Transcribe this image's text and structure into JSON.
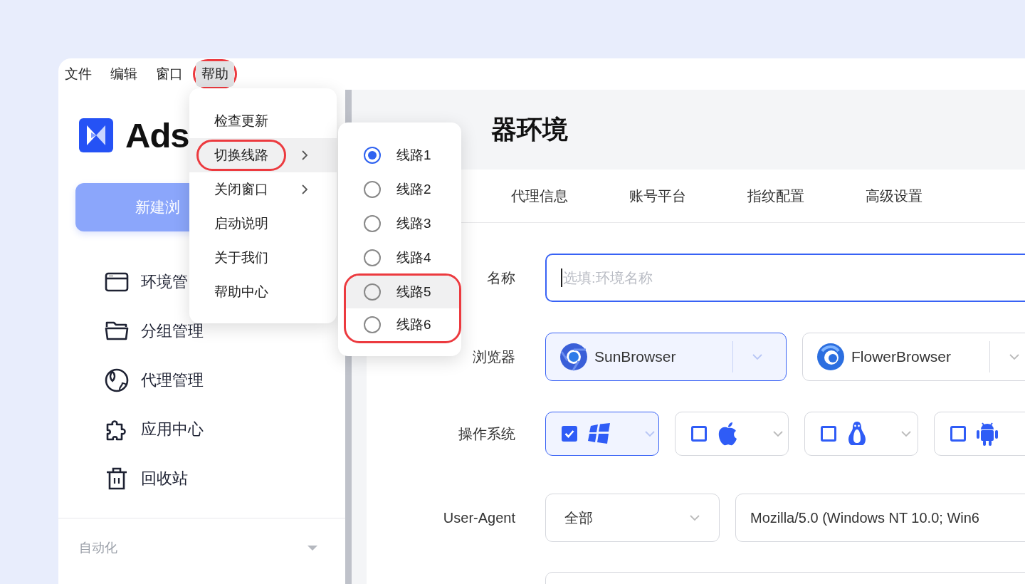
{
  "menubar": [
    {
      "label": "文件",
      "open": false,
      "annotated": false
    },
    {
      "label": "编辑",
      "open": false,
      "annotated": false
    },
    {
      "label": "窗口",
      "open": false,
      "annotated": false
    },
    {
      "label": "帮助",
      "open": true,
      "annotated": true
    }
  ],
  "help_menu": [
    {
      "label": "检查更新",
      "submenu": false,
      "highlighted": false,
      "annotated": false
    },
    {
      "label": "切换线路",
      "submenu": true,
      "highlighted": true,
      "annotated": true
    },
    {
      "label": "关闭窗口",
      "submenu": true,
      "highlighted": false,
      "annotated": false
    },
    {
      "label": "启动说明",
      "submenu": false,
      "highlighted": false,
      "annotated": false
    },
    {
      "label": "关于我们",
      "submenu": false,
      "highlighted": false,
      "annotated": false
    },
    {
      "label": "帮助中心",
      "submenu": false,
      "highlighted": false,
      "annotated": false
    }
  ],
  "route_menu": [
    {
      "label": "线路1",
      "selected": true,
      "highlighted": false,
      "annotated": false
    },
    {
      "label": "线路2",
      "selected": false,
      "highlighted": false,
      "annotated": false
    },
    {
      "label": "线路3",
      "selected": false,
      "highlighted": false,
      "annotated": false
    },
    {
      "label": "线路4",
      "selected": false,
      "highlighted": false,
      "annotated": false
    },
    {
      "label": "线路5",
      "selected": false,
      "highlighted": true,
      "annotated": true
    },
    {
      "label": "线路6",
      "selected": false,
      "highlighted": false,
      "annotated": true
    }
  ],
  "sidebar": {
    "logo_text": "Ads",
    "new_button": "新建浏",
    "nav": [
      {
        "label": "环境管",
        "selected": false
      },
      {
        "label": "分组管理",
        "selected": false
      },
      {
        "label": "代理管理",
        "selected": false
      },
      {
        "label": "应用中心",
        "selected": false
      },
      {
        "label": "回收站",
        "selected": false
      }
    ],
    "section": {
      "label": "自动化",
      "expanded": true
    }
  },
  "main": {
    "title": "器环境",
    "tabs": [
      {
        "label": "代理信息",
        "selected": false
      },
      {
        "label": "账号平台",
        "selected": false
      },
      {
        "label": "指纹配置",
        "selected": false
      },
      {
        "label": "高级设置",
        "selected": false
      }
    ],
    "form": {
      "name": {
        "label": "名称",
        "placeholder": "选填:环境名称",
        "focused": true
      },
      "browser": {
        "label": "浏览器",
        "options": [
          {
            "label": "SunBrowser",
            "selected": true
          },
          {
            "label": "FlowerBrowser",
            "selected": false
          }
        ]
      },
      "os": {
        "label": "操作系统",
        "options": [
          {
            "checked": true
          },
          {
            "checked": false
          },
          {
            "checked": false
          },
          {
            "checked": false
          }
        ]
      },
      "user_agent": {
        "label": "User-Agent",
        "mode": "全部",
        "value": "Mozilla/5.0 (Windows NT 10.0; Win6"
      }
    }
  }
}
